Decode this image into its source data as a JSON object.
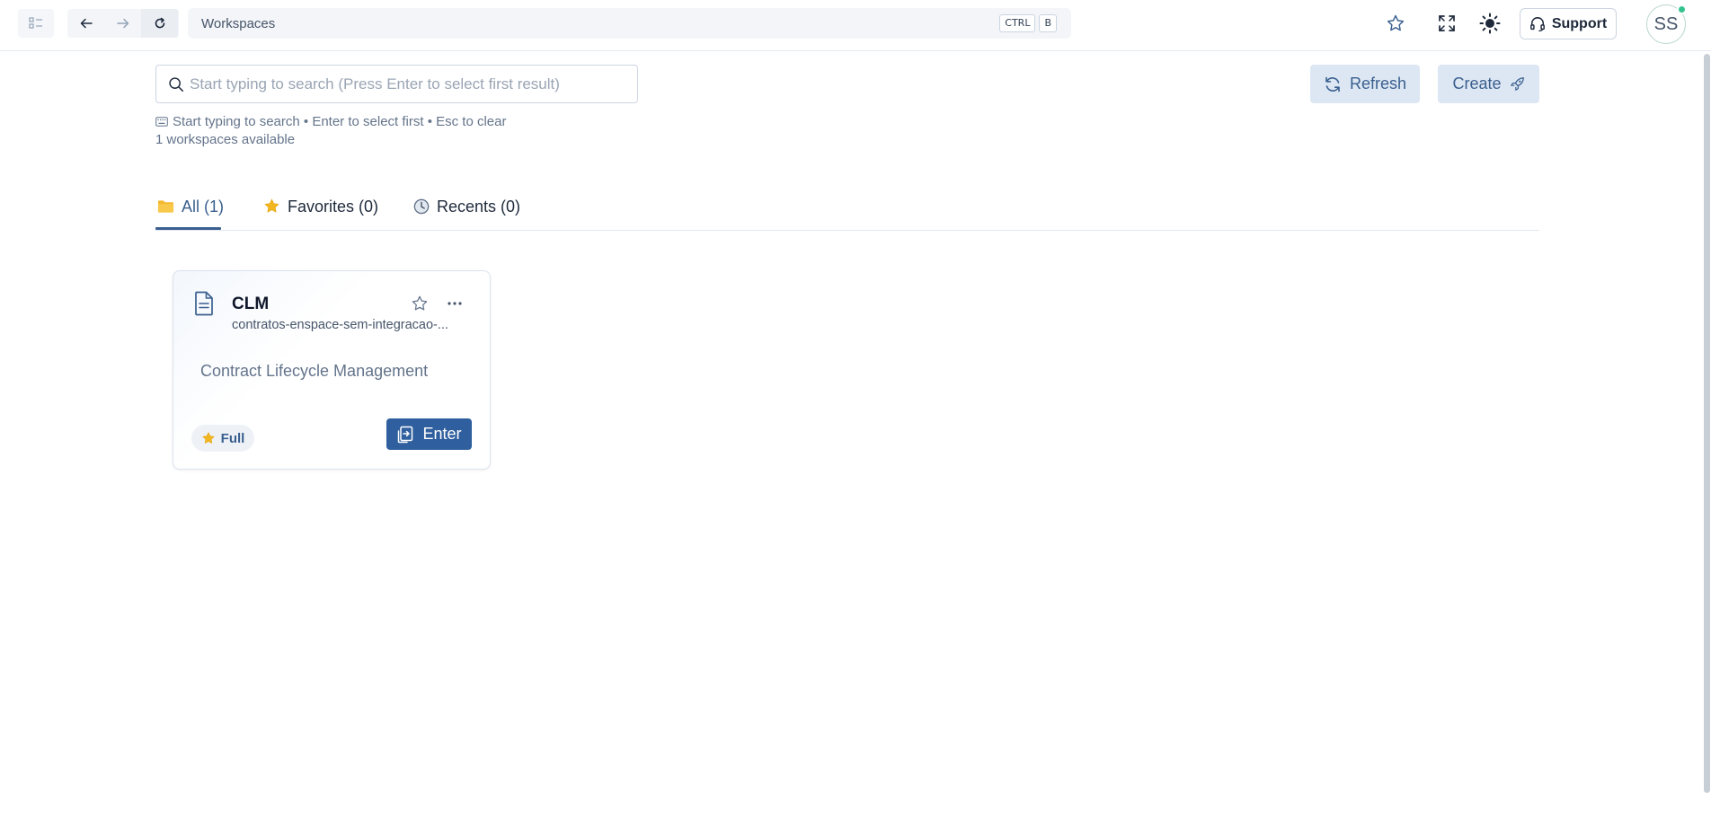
{
  "topbar": {
    "address_text": "Workspaces",
    "shortcut_keys": [
      "CTRL",
      "B"
    ],
    "support_label": "Support",
    "avatar_initials": "SS"
  },
  "search": {
    "placeholder": "Start typing to search (Press Enter to select first result)",
    "value": "",
    "hint": "Start typing to search • Enter to select first • Esc to clear",
    "count_text": "1 workspaces available"
  },
  "actions": {
    "refresh_label": "Refresh",
    "create_label": "Create"
  },
  "tabs": [
    {
      "label": "All (1)",
      "icon": "folder-icon",
      "active": true
    },
    {
      "label": "Favorites (0)",
      "icon": "star-icon",
      "active": false
    },
    {
      "label": "Recents (0)",
      "icon": "clock-icon",
      "active": false
    }
  ],
  "workspaces": [
    {
      "title": "CLM",
      "slug": "contratos-enspace-sem-integracao-...",
      "description": "Contract Lifecycle Management",
      "access_badge": "Full",
      "enter_label": "Enter"
    }
  ],
  "colors": {
    "accent": "#3a5f8f",
    "primary_button": "#2f5f9e",
    "secondary_button_bg": "#dde7f3",
    "folder": "#f5b82e",
    "star": "#f2b61f",
    "status_online": "#34c38f"
  }
}
